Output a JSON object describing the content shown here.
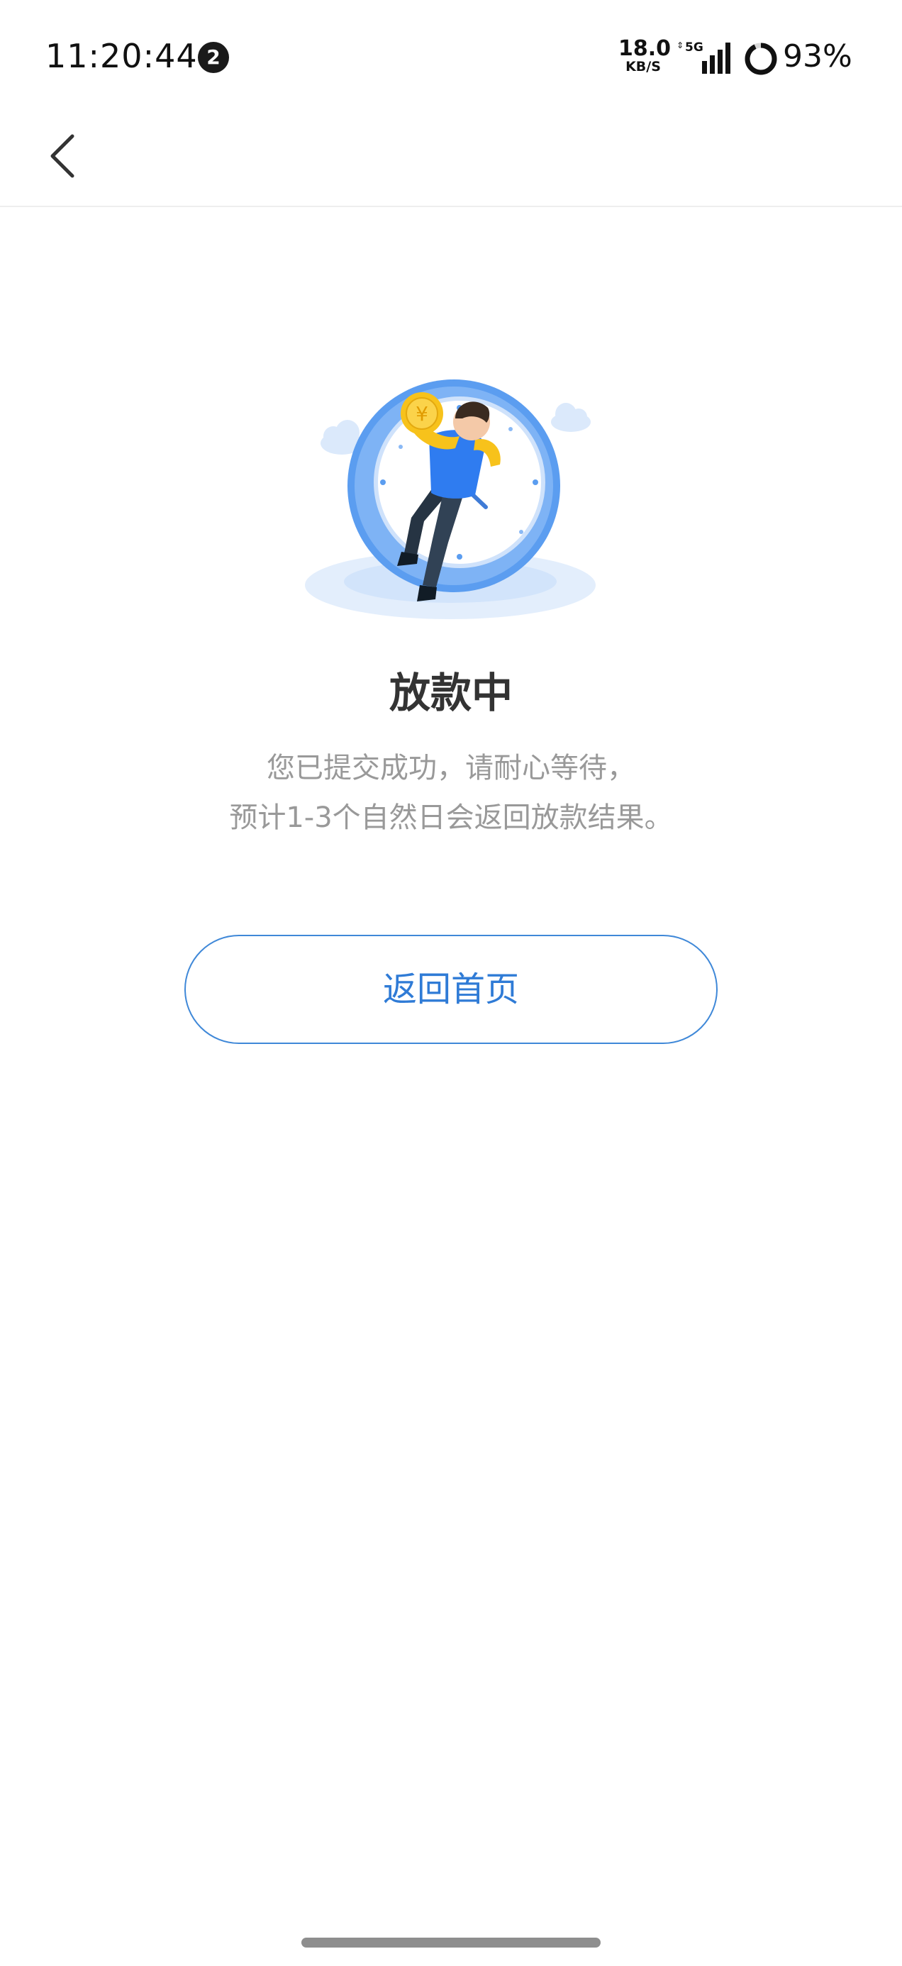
{
  "status_bar": {
    "time": "11:20:44",
    "notification_count": "2",
    "net_speed_value": "18.0",
    "net_speed_unit": "KB/S",
    "network_type": "5G",
    "battery_percent": "93%"
  },
  "nav": {
    "back_icon": "chevron-left-icon"
  },
  "main": {
    "illustration": "person-relaxing-on-clock-with-yuan-coin",
    "title": "放款中",
    "description_line1": "您已提交成功，请耐心等待，",
    "description_line2": "预计1-3个自然日会返回放款结果。",
    "home_button_label": "返回首页"
  },
  "colors": {
    "accent": "#2f7bd6",
    "button_border": "#3f88d8",
    "title": "#333333",
    "description": "#999999",
    "clock_blue": "#5b9df0",
    "shirt_blue": "#2f7cf0",
    "coin_yellow": "#f7c21b"
  }
}
